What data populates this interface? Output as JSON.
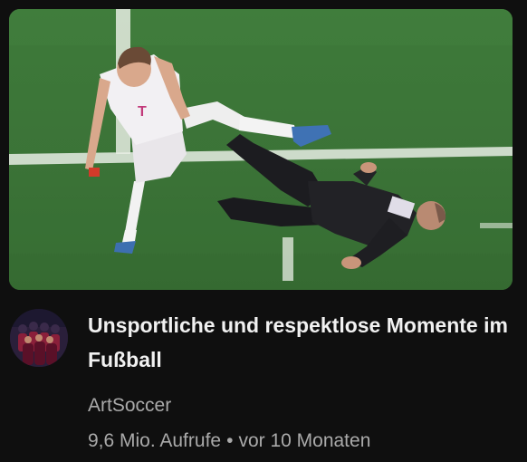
{
  "video": {
    "title": "Unsportliche und respektlose Momente im Fußball",
    "channel": "ArtSoccer",
    "views": "9,6 Mio. Aufrufe",
    "separator": "•",
    "age": "vor 10 Monaten"
  },
  "thumbnail": {
    "icon": "football-match-thumbnail",
    "shirt_logo": "T"
  },
  "avatar": {
    "icon": "channel-avatar-team-photo"
  },
  "colors": {
    "background": "#0f0f0f",
    "title": "#f1f1f1",
    "secondary_text": "#aaaaaa",
    "pitch_green": "#3f7a38"
  }
}
